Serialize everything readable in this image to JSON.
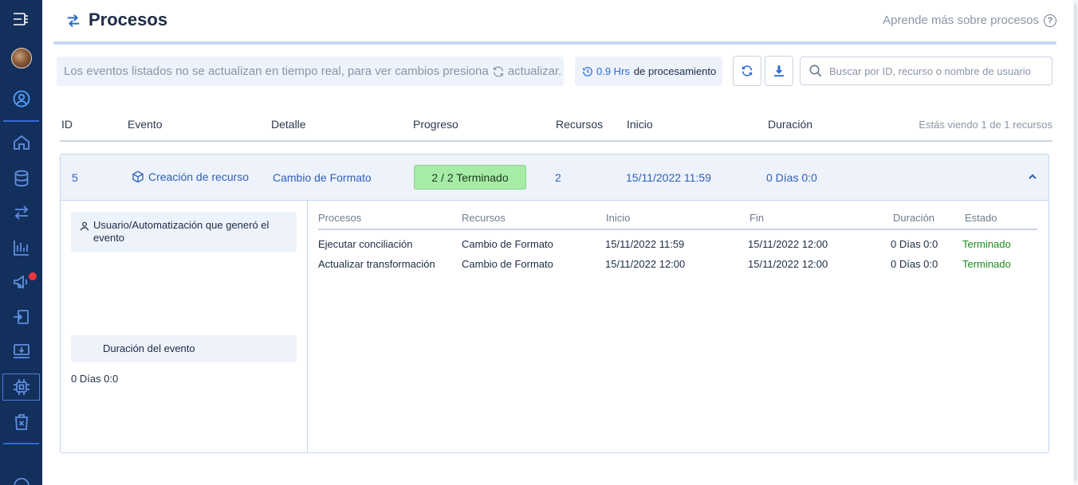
{
  "header": {
    "title": "Procesos",
    "help_link": "Aprende más sobre procesos",
    "help_icon_glyph": "?"
  },
  "toolbar": {
    "notice_text_before": "Los eventos listados no se actualizan en tiempo real, para ver cambios presiona",
    "notice_text_after": "actualizar.",
    "hrs_value": "0.9 Hrs",
    "hrs_label": "de procesamiento",
    "search_placeholder": "Buscar por ID, recurso o nombre de usuario"
  },
  "table": {
    "headers": [
      "ID",
      "Evento",
      "Detalle",
      "Progreso",
      "Recursos",
      "Inicio",
      "Duración"
    ],
    "count_text": "Estás viendo 1 de 1 recursos",
    "event": {
      "id": "5",
      "evento": "Creación de recurso",
      "detalle": "Cambio de Formato",
      "progreso": "2 / 2 Terminado",
      "recursos": "2",
      "inicio": "15/11/2022 11:59",
      "duracion": "0 Días 0:0"
    }
  },
  "detail": {
    "user_label": "Usuario/Automatización que generó el evento",
    "duration_label": "Duración del evento",
    "duration_value": "0 Días 0:0"
  },
  "processes": {
    "headers": [
      "Procesos",
      "Recursos",
      "Inicio",
      "Fin",
      "Duración",
      "Estado"
    ],
    "rows": [
      {
        "proceso": "Ejecutar conciliación",
        "recurso": "Cambio de Formato",
        "inicio": "15/11/2022 11:59",
        "fin": "15/11/2022 12:00",
        "duracion": "0 Días 0:0",
        "estado": "Terminado"
      },
      {
        "proceso": "Actualizar transformación",
        "recurso": "Cambio de Formato",
        "inicio": "15/11/2022 12:00",
        "fin": "15/11/2022 12:00",
        "duracion": "0 Días 0:0",
        "estado": "Terminado"
      }
    ]
  },
  "colors": {
    "sidebar_bg": "#132f5c",
    "accent_blue": "#2f6bd8",
    "progress_green": "#a6eca6",
    "status_done": "#1f8a1f",
    "notif_red": "#f0343c"
  },
  "sidebar": {
    "icons": [
      "menu-tree-icon",
      "avatar",
      "user-circle-icon",
      "home-icon",
      "database-icon",
      "transfer-arrows-icon",
      "chart-bars-icon",
      "megaphone-icon",
      "import-icon",
      "monitor-download-icon",
      "processor-chip-icon",
      "trash-box-icon",
      "more-circle-icon"
    ]
  }
}
